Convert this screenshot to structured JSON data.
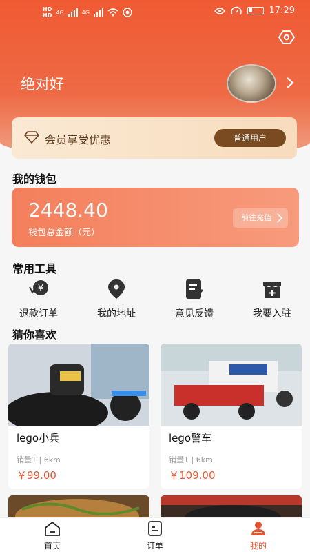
{
  "status": {
    "time": "17:29",
    "hd1": "HD",
    "hd2": "HD",
    "net1": "4G",
    "net2": "4G"
  },
  "profile": {
    "username": "绝对好"
  },
  "member": {
    "text": "会员享受优惠",
    "level_label": "普通用户"
  },
  "wallet": {
    "section_title": "我的钱包",
    "amount": "2448.40",
    "label": "钱包总金额（元）",
    "recharge_label": "前往充值"
  },
  "tools": {
    "section_title": "常用工具",
    "items": [
      {
        "label": "退款订单",
        "icon": "refund-icon"
      },
      {
        "label": "我的地址",
        "icon": "location-pin-icon"
      },
      {
        "label": "意见反馈",
        "icon": "feedback-icon"
      },
      {
        "label": "我要入驻",
        "icon": "shop-join-icon"
      }
    ]
  },
  "recommend": {
    "section_title": "猜你喜欢",
    "products": [
      {
        "name": "lego小兵",
        "sales": "销量1",
        "distance": "6km",
        "price": "￥99.00"
      },
      {
        "name": "lego警车",
        "sales": "销量1",
        "distance": "6km",
        "price": "￥109.00"
      }
    ]
  },
  "tabbar": {
    "items": [
      {
        "label": "首页",
        "icon": "home-icon"
      },
      {
        "label": "订单",
        "icon": "order-icon"
      },
      {
        "label": "我的",
        "icon": "user-icon"
      }
    ],
    "active_color": "#e5532f"
  },
  "colors": {
    "brand": "#ef5a33",
    "price": "#ea5a36",
    "member_btn": "#7a4a21"
  }
}
